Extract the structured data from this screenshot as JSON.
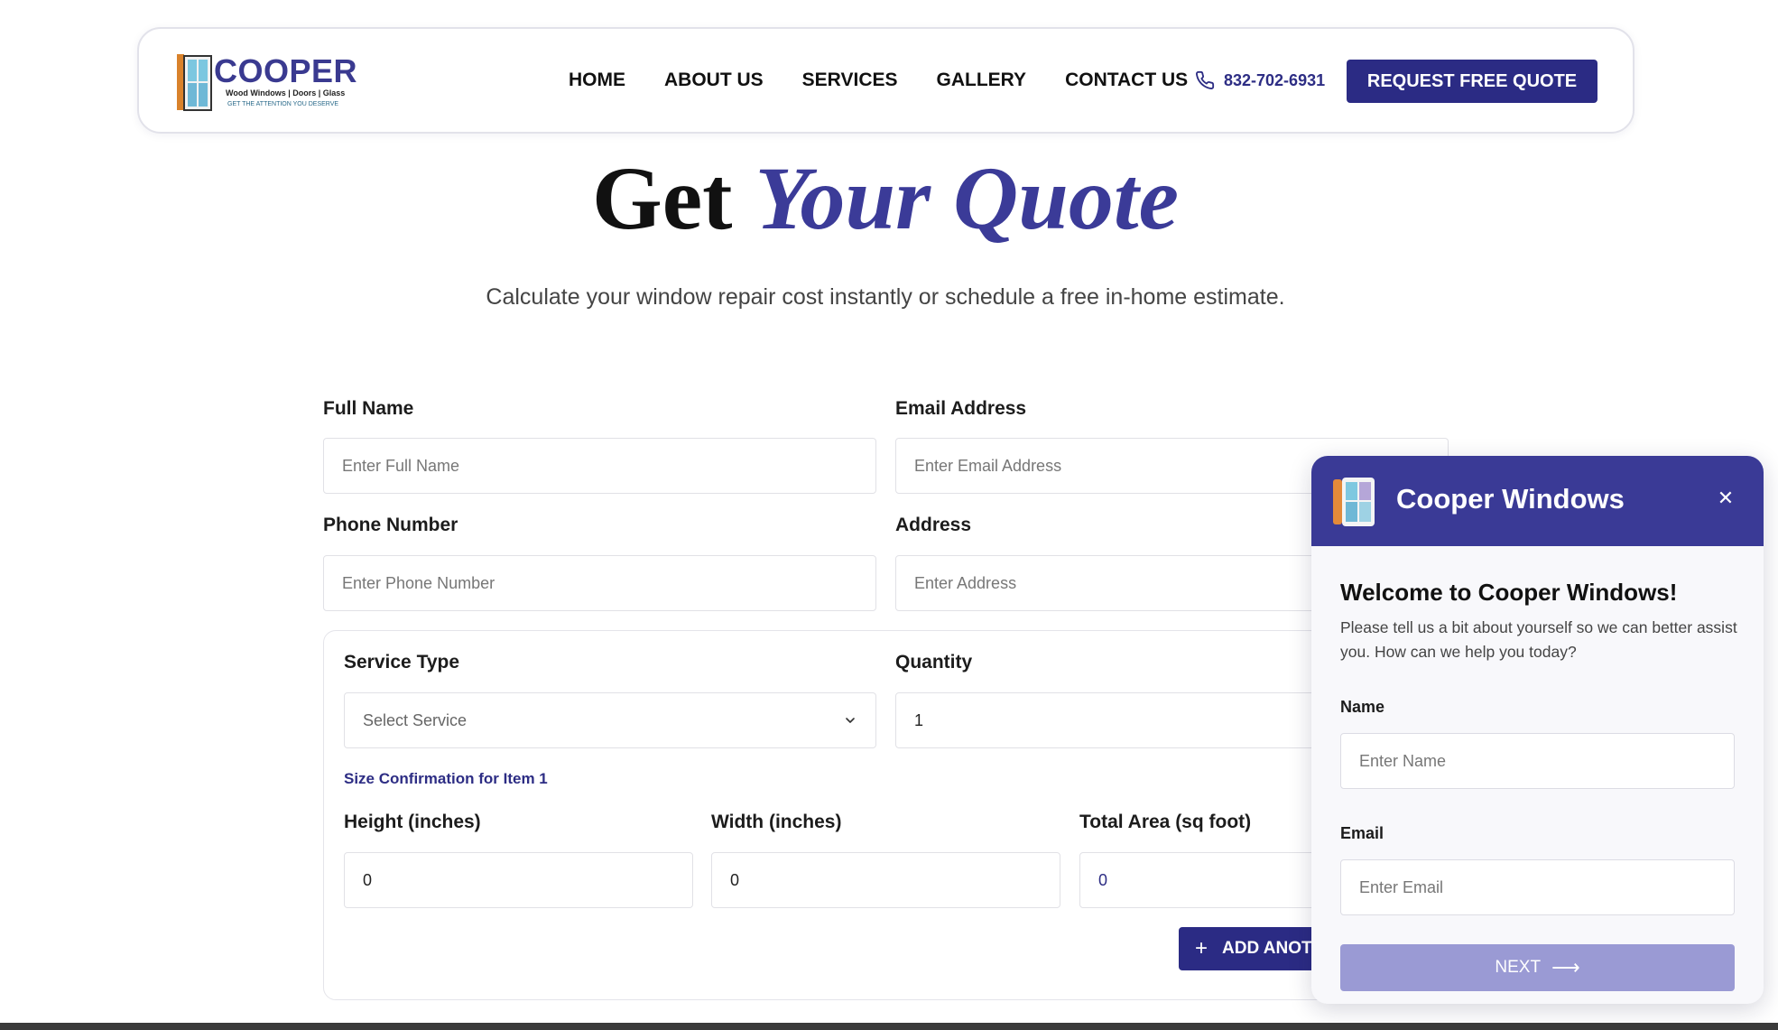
{
  "header": {
    "logo": {
      "brand": "COOPER",
      "subtitle": "Wood Windows | Doors | Glass",
      "tagline": "GET THE ATTENTION YOU DESERVE"
    },
    "nav": [
      "HOME",
      "ABOUT US",
      "SERVICES",
      "GALLERY",
      "CONTACT US"
    ],
    "phone": "832-702-6931",
    "cta_label": "REQUEST FREE QUOTE"
  },
  "hero": {
    "title_plain": "Get ",
    "title_accent": "Your Quote",
    "subtitle": "Calculate your window repair cost instantly or schedule a free in-home estimate."
  },
  "form": {
    "full_name": {
      "label": "Full Name",
      "placeholder": "Enter Full Name"
    },
    "email": {
      "label": "Email Address",
      "placeholder": "Enter Email Address"
    },
    "phone": {
      "label": "Phone Number",
      "placeholder": "Enter Phone Number"
    },
    "address": {
      "label": "Address",
      "placeholder": "Enter Address"
    },
    "item": {
      "service_type_label": "Service Type",
      "service_type_value": "Select Service",
      "quantity_label": "Quantity",
      "quantity_value": "1",
      "size_confirmation": "Size Confirmation for Item 1",
      "height_label": "Height (inches)",
      "height_value": "0",
      "width_label": "Width (inches)",
      "width_value": "0",
      "area_label": "Total Area (sq foot)",
      "area_value": "0",
      "add_label": "ADD ANOT"
    }
  },
  "chat": {
    "title": "Cooper Windows",
    "close_icon": "close-icon",
    "welcome": "Welcome to Cooper Windows!",
    "description": "Please tell us a bit about yourself so we can better assist you. How can we help you today?",
    "name_label": "Name",
    "name_placeholder": "Enter Name",
    "email_label": "Email",
    "email_placeholder": "Enter Email",
    "next_label": "NEXT"
  },
  "colors": {
    "brand": "#2b2b84",
    "accent": "#3b3b98",
    "next_disabled": "#9a9ad4"
  }
}
